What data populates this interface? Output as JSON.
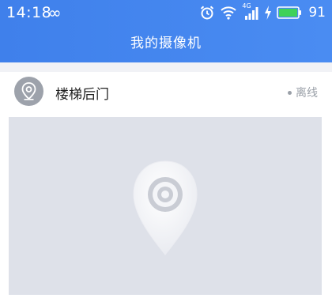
{
  "status_bar": {
    "time": "14:18",
    "loop_icon": "∞",
    "icons": [
      "alarm-icon",
      "wifi-icon",
      "signal-4g-icon",
      "charging-icon",
      "battery-icon"
    ],
    "network_type": "4G",
    "battery_level": "91"
  },
  "header": {
    "title": "我的摄像机"
  },
  "camera": {
    "name": "楼梯后门",
    "status": "离线"
  },
  "colors": {
    "header_blue": "#4287ef",
    "battery_green": "#3fd15a",
    "avatar_gray": "#9da2ab",
    "preview_bg": "#dee1e9"
  }
}
